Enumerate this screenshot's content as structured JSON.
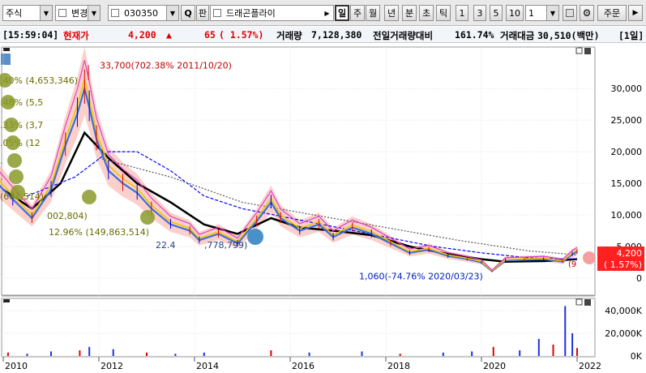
{
  "toolbar": {
    "type_select": "주식",
    "change_label": "변경",
    "code_input": "030350",
    "search_label": "Q",
    "pan_label": "판",
    "stock_name": "드래곤플라이",
    "period_tabs": [
      "일",
      "주",
      "월",
      "년",
      "분",
      "초",
      "틱"
    ],
    "active_period": "일",
    "number_buttons": [
      "1",
      "3",
      "5",
      "10"
    ],
    "count_select": "1",
    "order_button": "주문"
  },
  "quote": {
    "time": "[15:59:04]",
    "current_label": "현재가",
    "price": "4,200",
    "change_arrow": "▲",
    "change": "65",
    "change_pct": "( 1.57%)",
    "volume_label": "거래량",
    "volume": "7,128,380",
    "prev_volume_label": "전일거래량대비",
    "prev_volume_ratio": "161.74%",
    "value_label": "거래대금",
    "value": "30,510(백만)",
    "period": "[1일]"
  },
  "chart_data": {
    "type": "candlestick",
    "x_tick_labels": [
      "2010",
      "2012",
      "2014",
      "2016",
      "2018",
      "2020",
      "2022"
    ],
    "y_tick_labels": [
      "30,000",
      "25,000",
      "20,000",
      "15,000",
      "10,000",
      "5,000",
      "0"
    ],
    "ylim": [
      0,
      34000
    ],
    "volume_tick_labels": [
      "40,000K",
      "20,000K",
      "0K"
    ],
    "volume_ylim": [
      0,
      50000
    ],
    "price_series": {
      "dates": [
        2009.75,
        2010.2,
        2010.6,
        2011.0,
        2011.3,
        2011.55,
        2011.7,
        2011.8,
        2011.95,
        2012.2,
        2012.5,
        2012.8,
        2013.1,
        2013.5,
        2013.9,
        2014.1,
        2014.5,
        2014.9,
        2015.3,
        2015.6,
        2015.8,
        2016.2,
        2016.6,
        2016.9,
        2017.3,
        2017.7,
        2018.1,
        2018.5,
        2018.9,
        2019.3,
        2019.7,
        2020.0,
        2020.22,
        2020.5,
        2020.9,
        2021.3,
        2021.7,
        2021.9,
        2022.0
      ],
      "values": [
        16000,
        12500,
        9500,
        14000,
        21000,
        26000,
        30000,
        27000,
        22000,
        17000,
        15000,
        13500,
        11000,
        8500,
        7500,
        6000,
        7000,
        5500,
        9000,
        12000,
        9500,
        7500,
        8500,
        6500,
        8000,
        7000,
        5500,
        4000,
        4500,
        3500,
        3000,
        2500,
        1100,
        2800,
        2900,
        3000,
        2600,
        3800,
        4200
      ]
    },
    "ma_series": [
      {
        "color": "#000000",
        "dates": [
          2010.0,
          2010.6,
          2011.2,
          2011.7,
          2012.2,
          2012.8,
          2013.5,
          2014.2,
          2014.9,
          2015.6,
          2016.2,
          2016.9,
          2017.7,
          2018.5,
          2019.3,
          2020.0,
          2020.5,
          2021.3,
          2022.0
        ],
        "values": [
          14000,
          11000,
          15000,
          23000,
          19000,
          15000,
          12000,
          8500,
          7000,
          9500,
          8000,
          7500,
          6800,
          5000,
          3800,
          3000,
          2600,
          2700,
          3000
        ]
      },
      {
        "color": "#0000ff",
        "dates": [
          2010.5,
          2011.5,
          2012.2,
          2012.8,
          2013.5,
          2014.2,
          2015.0,
          2016.0,
          2017.0,
          2018.0,
          2019.0,
          2020.0,
          2021.0,
          2022.0
        ],
        "values": [
          13000,
          16000,
          20000,
          20000,
          17000,
          13000,
          11000,
          9500,
          8000,
          6500,
          5000,
          4000,
          3200,
          3000
        ]
      },
      {
        "color": "#555555",
        "dates": [
          2012.0,
          2013.5,
          2015.0,
          2016.5,
          2018.0,
          2019.5,
          2021.0,
          2022.0
        ],
        "values": [
          19000,
          16000,
          12000,
          10000,
          8000,
          6000,
          4300,
          3700
        ]
      }
    ],
    "volume_series": {
      "dates": [
        2010.1,
        2010.5,
        2011.0,
        2011.6,
        2011.8,
        2012.3,
        2013.0,
        2013.6,
        2014.2,
        2015.6,
        2016.4,
        2017.5,
        2018.3,
        2019.2,
        2019.8,
        2020.25,
        2020.8,
        2021.2,
        2021.5,
        2021.75,
        2021.9,
        2022.0
      ],
      "values": [
        3000,
        2000,
        4000,
        5000,
        8000,
        6000,
        3000,
        2000,
        3000,
        5000,
        3000,
        4000,
        2000,
        3000,
        4000,
        8000,
        5000,
        15000,
        10000,
        44000,
        20000,
        7000
      ]
    },
    "annotations": {
      "high": "33,700(702.38% 2011/10/20)",
      "low": "1,060(-74.76% 2020/03/23)",
      "left_labels": [
        ".40% (4,653,346)",
        ".48% (5,5",
        ".33% (3,7",
        ".05% (12",
        ".",
        ".",
        "(601,514)",
        "002,804)",
        "12.96% (149,863,514)"
      ],
      "mid_label_a": "22.4",
      "mid_label_b": ",778,799)",
      "right_hint": "(9"
    },
    "last_price_label": "4,200",
    "last_change_label": "( 1.57%)"
  }
}
